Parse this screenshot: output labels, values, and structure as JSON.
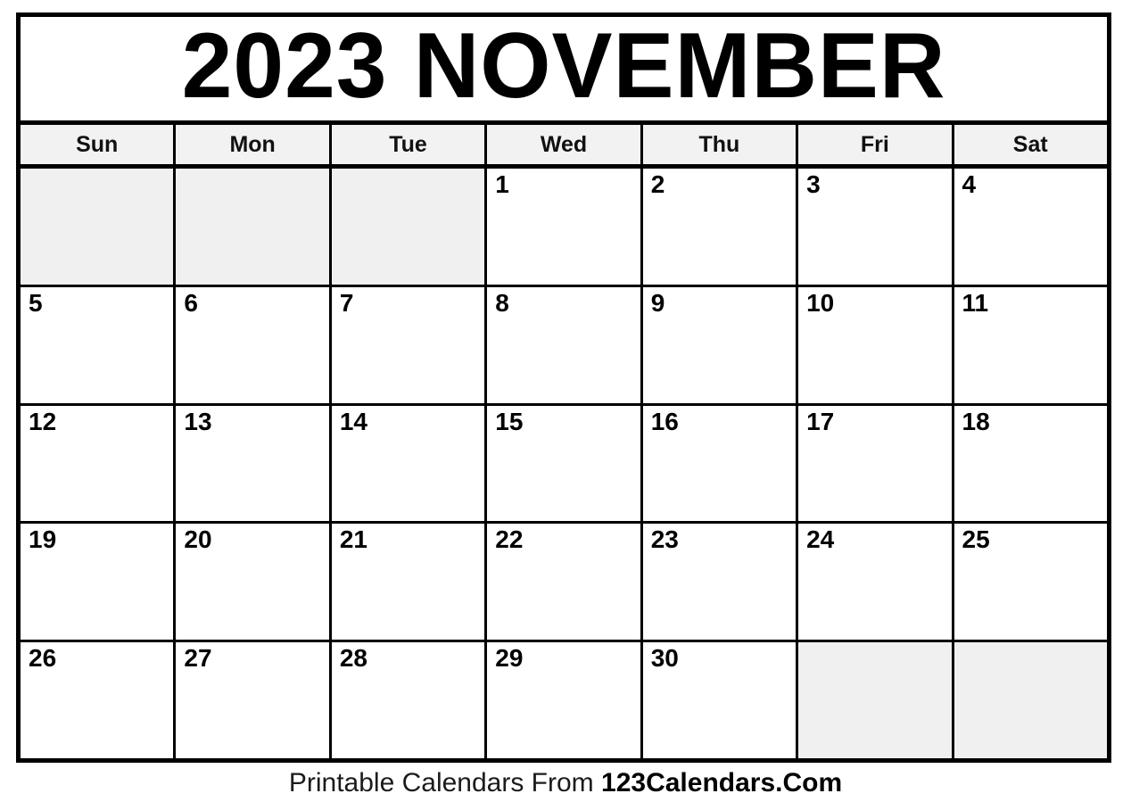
{
  "calendar": {
    "title": "2023 NOVEMBER",
    "year": "2023",
    "month": "NOVEMBER",
    "weekday_headers": [
      {
        "label": "Sun"
      },
      {
        "label": "Mon"
      },
      {
        "label": "Tue"
      },
      {
        "label": "Wed"
      },
      {
        "label": "Thu"
      },
      {
        "label": "Fri"
      },
      {
        "label": "Sat"
      }
    ],
    "weeks": [
      {
        "days": [
          {
            "date": "",
            "blank": true
          },
          {
            "date": "",
            "blank": true
          },
          {
            "date": "",
            "blank": true
          },
          {
            "date": "1",
            "blank": false
          },
          {
            "date": "2",
            "blank": false
          },
          {
            "date": "3",
            "blank": false
          },
          {
            "date": "4",
            "blank": false
          }
        ]
      },
      {
        "days": [
          {
            "date": "5",
            "blank": false
          },
          {
            "date": "6",
            "blank": false
          },
          {
            "date": "7",
            "blank": false
          },
          {
            "date": "8",
            "blank": false
          },
          {
            "date": "9",
            "blank": false
          },
          {
            "date": "10",
            "blank": false
          },
          {
            "date": "11",
            "blank": false
          }
        ]
      },
      {
        "days": [
          {
            "date": "12",
            "blank": false
          },
          {
            "date": "13",
            "blank": false
          },
          {
            "date": "14",
            "blank": false
          },
          {
            "date": "15",
            "blank": false
          },
          {
            "date": "16",
            "blank": false
          },
          {
            "date": "17",
            "blank": false
          },
          {
            "date": "18",
            "blank": false
          }
        ]
      },
      {
        "days": [
          {
            "date": "19",
            "blank": false
          },
          {
            "date": "20",
            "blank": false
          },
          {
            "date": "21",
            "blank": false
          },
          {
            "date": "22",
            "blank": false
          },
          {
            "date": "23",
            "blank": false
          },
          {
            "date": "24",
            "blank": false
          },
          {
            "date": "25",
            "blank": false
          }
        ]
      },
      {
        "days": [
          {
            "date": "26",
            "blank": false
          },
          {
            "date": "27",
            "blank": false
          },
          {
            "date": "28",
            "blank": false
          },
          {
            "date": "29",
            "blank": false
          },
          {
            "date": "30",
            "blank": false
          },
          {
            "date": "",
            "blank": true
          },
          {
            "date": "",
            "blank": true
          }
        ]
      }
    ]
  },
  "footer": {
    "text": "Printable Calendars From ",
    "brand": "123Calendars.Com"
  },
  "colors": {
    "border": "#000000",
    "blank_cell": "#f0f0f0",
    "weekday_header_bg": "#f2f2f2",
    "page_bg": "#ffffff",
    "text": "#000000"
  }
}
